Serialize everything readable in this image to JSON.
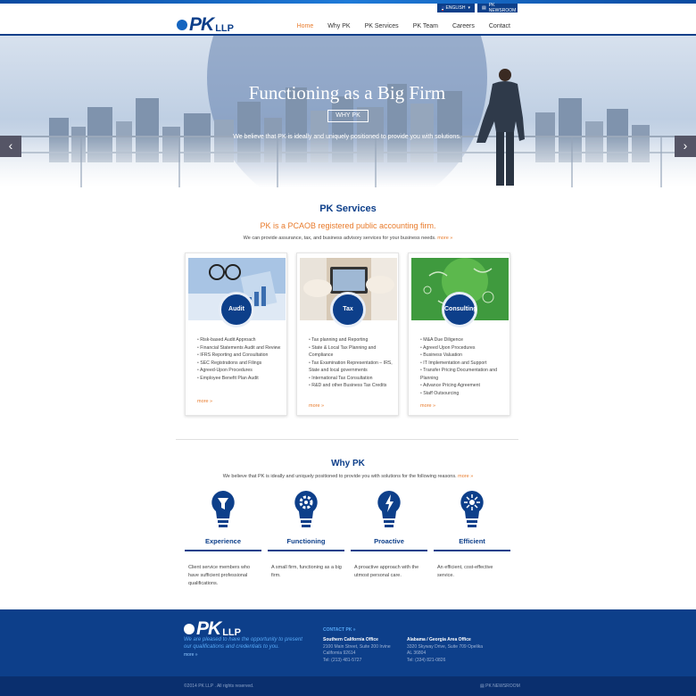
{
  "header": {
    "logo": "PK LLP",
    "logo_pk": "PK",
    "logo_llp": "LLP",
    "language": "ENGLISH",
    "newsroom": "PK NEWSROOM",
    "nav": [
      "Home",
      "Why PK",
      "PK Services",
      "PK Team",
      "Careers",
      "Contact"
    ],
    "active": "Home"
  },
  "hero": {
    "title": "Functioning as a Big Firm",
    "button": "WHY PK",
    "subtitle": "We believe that PK is ideally and uniquely positioned to provide you with solutions."
  },
  "services": {
    "title": "PK Services",
    "subtitle": "PK is a PCAOB registered public accounting firm.",
    "description": "We can provide assurance, tax, and business advisory services for your business needs.",
    "more": "more »",
    "cards": [
      {
        "label": "Audit",
        "items": [
          "Risk-based Audit Approach",
          "Financial Statements Audit and Review",
          "IFRS Reporting and Consultation",
          "SEC Registrations and Filings",
          "Agreed-Upon Procedures",
          "Employee Benefit Plan Audit"
        ],
        "more": "more »"
      },
      {
        "label": "Tax",
        "items": [
          "Tax planning and Reporting",
          "State & Local Tax Planning and Compliance",
          "Tax Examination Representation – IRS, State and local governments",
          "International Tax Consultation",
          "R&D and other Business Tax Credits"
        ],
        "more": "more »"
      },
      {
        "label": "Consulting",
        "items": [
          "M&A Due Diligence",
          "Agreed Upon Procedures",
          "Business Valuation",
          "IT Implementation and Support",
          "Transfer Pricing Documentation and Planning",
          "Advance Pricing Agreement",
          "Staff Outsourcing"
        ],
        "more": "more »"
      }
    ]
  },
  "why": {
    "title": "Why PK",
    "description": "We believe that PK is ideally and uniquely positioned to provide you with solutions for the following reasons.",
    "more": "more »",
    "features": [
      {
        "label": "Experience",
        "text": "Client service members who have sufficient professional qualifications.",
        "icon": "funnel-bulb-icon"
      },
      {
        "label": "Functioning",
        "text": "A small firm, functioning as a big firm.",
        "icon": "gear-bulb-icon"
      },
      {
        "label": "Proactive",
        "text": "A proactive approach with the utmost personal care.",
        "icon": "lightning-bulb-icon"
      },
      {
        "label": "Efficient",
        "text": "An efficient, cost-effective service.",
        "icon": "spark-bulb-icon"
      }
    ]
  },
  "footer": {
    "tagline": "We are pleased to have the opportunity to present our qualifications and credentials to you.",
    "more": "more »",
    "contact": "CONTACT PK »",
    "offices": [
      {
        "name": "Southern California Office",
        "line1": "2100 Main Street, Suite 200 Irvine",
        "line2": "California 92614",
        "tel": "Tel: (213) 481-5727"
      },
      {
        "name": "Alabama / Georgia Area Office",
        "line1": "3320 Skyway Drive, Suite 709 Opelika",
        "line2": "AL 36804",
        "tel": "Tel: (334) 821-0826"
      }
    ],
    "copyright": "©2014 PK LLP . All rights reserved.",
    "newsroom": "PK NEWSROOM"
  },
  "colors": {
    "brand": "#0d3f8a",
    "accent": "#e87b2c"
  }
}
